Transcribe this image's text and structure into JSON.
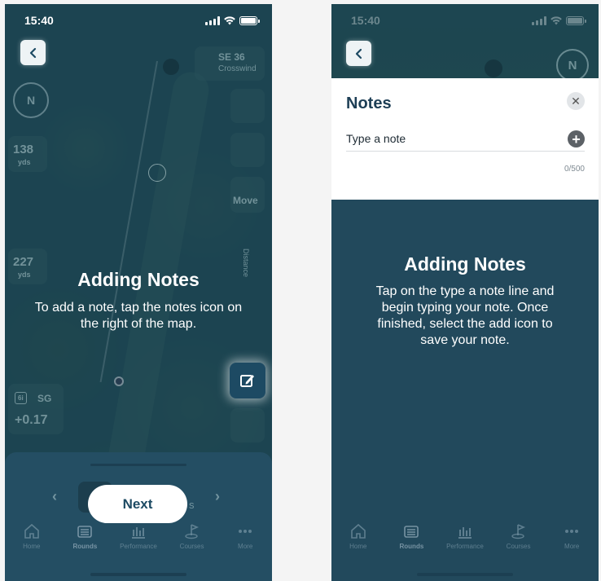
{
  "left": {
    "status": {
      "time": "15:40"
    },
    "map": {
      "wind": {
        "value": "SE 36",
        "label": "Crosswind"
      },
      "compass": "N",
      "distance_1": {
        "value": "138",
        "unit": "yds"
      },
      "distance_2": {
        "value": "227",
        "unit": "yds"
      },
      "move_label": "Move",
      "sg": {
        "badge": "6i",
        "label": "SG",
        "value": "+0.17"
      },
      "side_text": "Distance"
    },
    "overlay": {
      "title": "Adding Notes",
      "text": "To add a note, tap the notes icon on the right of the map."
    },
    "pager": {
      "partial_text": "s"
    },
    "next_label": "Next",
    "tabs": [
      "Home",
      "Rounds",
      "Performance",
      "Courses",
      "More"
    ]
  },
  "right": {
    "status": {
      "time": "15:40"
    },
    "compass": "N",
    "notes": {
      "title": "Notes",
      "placeholder": "Type a note",
      "count": "0/500"
    },
    "overlay": {
      "title": "Adding Notes",
      "text": "Tap on the type a note line and begin typing your note. Once finished, select the add icon to save your note."
    },
    "tabs": [
      "Home",
      "Rounds",
      "Performance",
      "Courses",
      "More"
    ]
  },
  "colors": {
    "overlay": "#1f4b5e",
    "accent": "#1d4a63",
    "white": "#ffffff"
  }
}
